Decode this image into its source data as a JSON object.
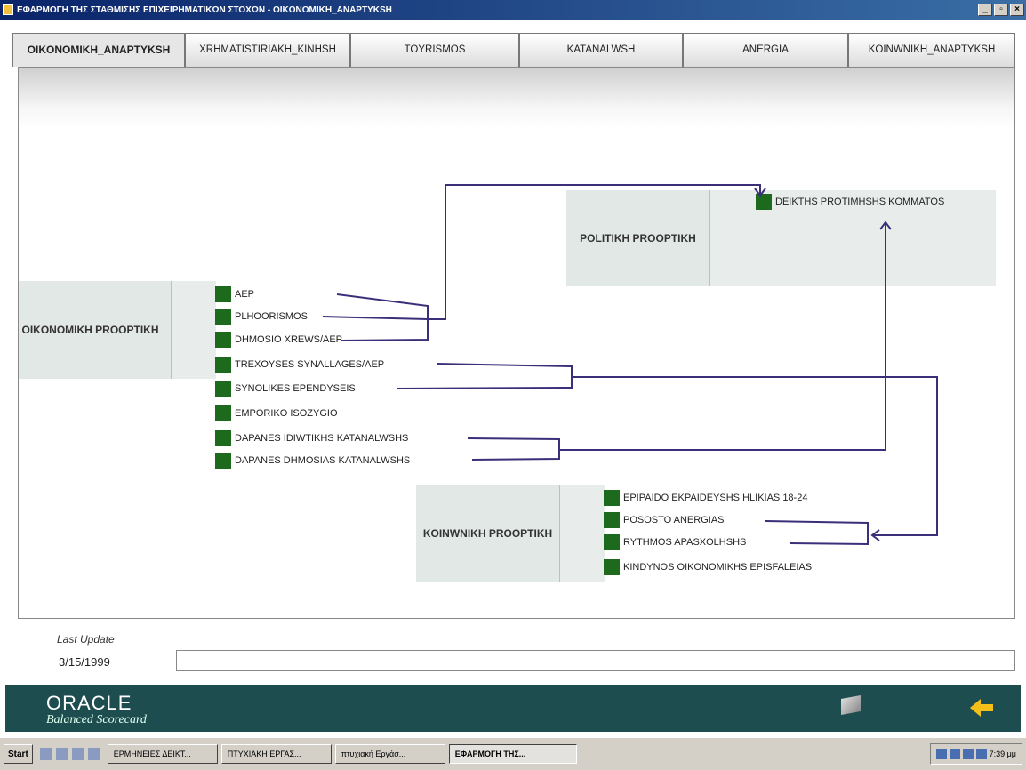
{
  "window": {
    "title": "ΕΦΑΡΜΟΓΗ ΤΗΣ ΣΤΑΘΜΙΣΗΣ ΕΠΙΧΕΙΡΗΜΑΤΙΚΩΝ ΣΤΟΧΩΝ - OIKONOMIKH_ANAPTYKSH",
    "controls": [
      "_",
      "▫",
      "×"
    ]
  },
  "tabs": [
    {
      "label": "OIKONOMIKH_ANAPTYKSH"
    },
    {
      "label": "XRHMATISTIRIAKH_KINHSH"
    },
    {
      "label": "TOYRISMOS"
    },
    {
      "label": "KATANALWSH"
    },
    {
      "label": "ANERGIA"
    },
    {
      "label": "KOINWNIKH_ANAPTYKSH"
    }
  ],
  "perspectives": {
    "politikh": {
      "label": "POLITIKH PROOPTIKH",
      "items": [
        "DEIKTHS PROTIMHSHS KOMMATOS"
      ]
    },
    "oikonomikh": {
      "label": "OIKONOMIKH PROOPTIKH",
      "items": [
        "AEP",
        "PLHOORISMOS",
        "DHMOSIO XREWS/AEP",
        "TREXOYSES SYNALLAGES/AEP",
        "SYNOLIKES EPENDYSEIS",
        "EMPORIKO ISOZYGIO",
        "DAPANES IDIWTIKHS KATANALWSHS",
        "DAPANES DHMOSIAS KATANALWSHS"
      ]
    },
    "koinwnikh": {
      "label": "KOINWNIKH PROOPTIKH",
      "items": [
        "EPIPAIDO EKPAIDEYSHS HLIKIAS 18-24",
        "POSOSTO ANERGIAS",
        "RYTHMOS APASXOLHSHS",
        "KINDYNOS OIKONOMIKHS EPISFALEIAS"
      ]
    }
  },
  "last_update": {
    "label": "Last Update",
    "date": "3/15/1999",
    "value": ""
  },
  "footer": {
    "brand": "ORACLE",
    "product": "Balanced Scorecard"
  },
  "taskbar": {
    "start": "Start",
    "buttons": [
      "ΕΡΜΗΝΕΙΕΣ ΔΕΙΚΤ...",
      "ΠΤΥΧΙΑΚΗ ΕΡΓΑΣ...",
      "πτυχιακή Εργάσ...",
      "ΕΦΑΡΜΟΓΗ ΤΗΣ..."
    ],
    "clock": "7:39 μμ"
  },
  "colors": {
    "indicator": "#1d6a1d",
    "link_line": "#3b2f7a",
    "footer_bg": "#1e4d50",
    "titlebar": "#0a246a"
  }
}
